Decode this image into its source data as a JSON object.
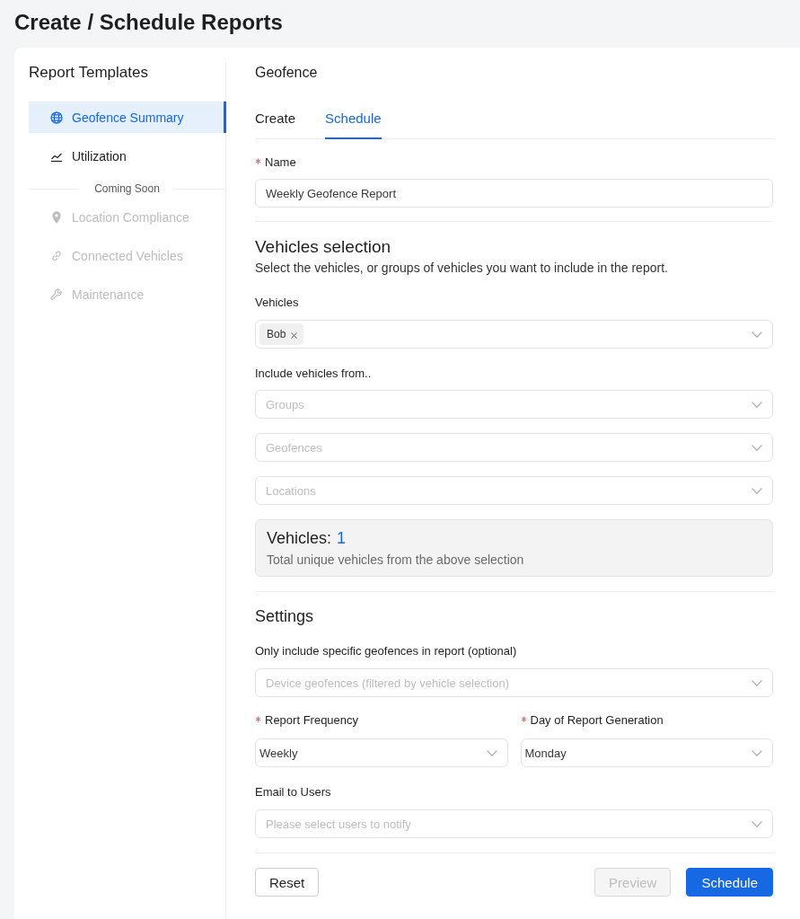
{
  "page": {
    "title": "Create / Schedule Reports"
  },
  "sidebar": {
    "title": "Report Templates",
    "items": [
      {
        "label": "Geofence Summary",
        "selected": true
      },
      {
        "label": "Utilization",
        "selected": false
      }
    ],
    "divider_label": "Coming Soon",
    "coming_soon": [
      {
        "label": "Location Compliance",
        "disabled": true
      },
      {
        "label": "Connected Vehicles",
        "disabled": true
      },
      {
        "label": "Maintenance",
        "disabled": true
      }
    ]
  },
  "panel": {
    "title": "Geofence",
    "tabs": [
      {
        "label": "Create",
        "selected": false
      },
      {
        "label": "Schedule",
        "selected": true
      }
    ]
  },
  "name_field": {
    "label": "Name",
    "required": true,
    "value": "Weekly Geofence Report"
  },
  "vehicles_selection": {
    "title": "Vehicles selection",
    "description": "Select the vehicles, or groups of vehicles you want to include in the report.",
    "vehicles": {
      "label": "Vehicles",
      "tags": [
        "Bob"
      ]
    },
    "include_label": "Include vehicles from..",
    "sources": [
      {
        "placeholder": "Groups"
      },
      {
        "placeholder": "Geofences"
      },
      {
        "placeholder": "Locations"
      }
    ],
    "summary": {
      "label": "Vehicles:",
      "count": "1",
      "note": "Total unique vehicles from the above selection"
    }
  },
  "settings": {
    "title": "Settings",
    "geofences": {
      "label": "Only include specific geofences in report (optional)",
      "placeholder": "Device geofences (filtered by vehicle selection)"
    },
    "frequency": {
      "label": "Report Frequency",
      "required": true,
      "value": "Weekly"
    },
    "day": {
      "label": "Day of Report Generation",
      "required": true,
      "value": "Monday"
    },
    "email": {
      "label": "Email to Users",
      "placeholder": "Please select users to notify"
    }
  },
  "actions": [
    {
      "label": "Reset",
      "kind": "default",
      "disabled": false
    },
    {
      "label": "Preview",
      "kind": "default",
      "disabled": true
    },
    {
      "label": "Schedule",
      "kind": "primary",
      "disabled": false
    }
  ]
}
